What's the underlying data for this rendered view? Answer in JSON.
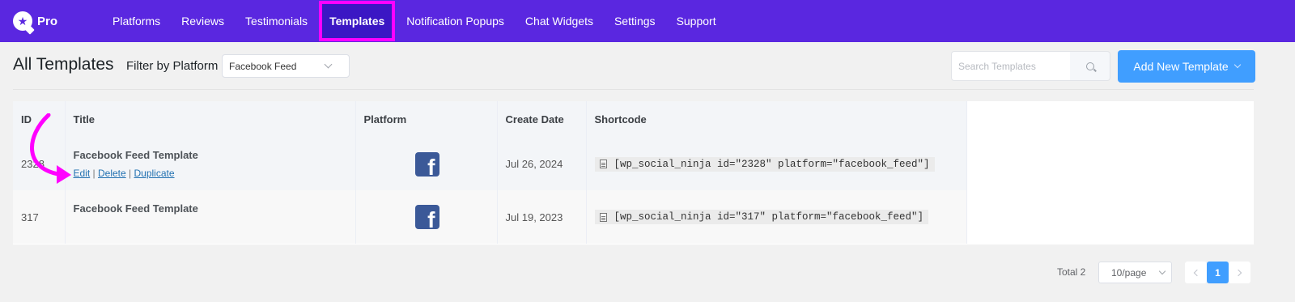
{
  "brand": {
    "name": "Pro"
  },
  "nav": {
    "items": [
      {
        "label": "Platforms"
      },
      {
        "label": "Reviews"
      },
      {
        "label": "Testimonials"
      },
      {
        "label": "Templates",
        "active": true
      },
      {
        "label": "Notification Popups"
      },
      {
        "label": "Chat Widgets"
      },
      {
        "label": "Settings"
      },
      {
        "label": "Support"
      }
    ]
  },
  "header": {
    "title": "All Templates",
    "filter_label": "Filter by Platform",
    "filter_value": "Facebook Feed",
    "search_placeholder": "Search Templates",
    "add_button": "Add New Template"
  },
  "table": {
    "columns": [
      "ID",
      "Title",
      "Platform",
      "Create Date",
      "Shortcode"
    ],
    "rows": [
      {
        "id": "2328",
        "title": "Facebook Feed Template",
        "actions": {
          "edit": "Edit",
          "delete": "Delete",
          "duplicate": "Duplicate",
          "sep": "|"
        },
        "platform_icon": "facebook-icon",
        "date": "Jul 26, 2024",
        "shortcode": "[wp_social_ninja id=\"2328\" platform=\"facebook_feed\"]"
      },
      {
        "id": "317",
        "title": "Facebook Feed Template",
        "platform_icon": "facebook-icon",
        "date": "Jul 19, 2023",
        "shortcode": "[wp_social_ninja id=\"317\" platform=\"facebook_feed\"]"
      }
    ]
  },
  "pagination": {
    "total": "Total 2",
    "page_size": "10/page",
    "current_page": "1"
  },
  "colors": {
    "nav_bg": "#5a27e0",
    "highlight": "#ff00ff",
    "primary": "#409eff",
    "facebook": "#3b5998"
  }
}
